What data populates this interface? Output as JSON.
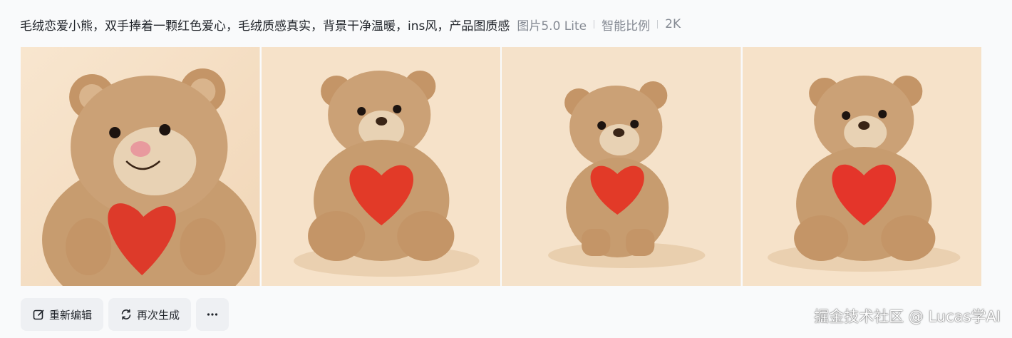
{
  "prompt": {
    "text": "毛绒恋爱小熊，双手捧着一颗红色爱心，毛绒质感真实，背景干净温暖，ins风，产品图质感",
    "model": "图片5.0 Lite",
    "ratio": "智能比例",
    "resolution": "2K"
  },
  "images": [
    {
      "name": "generated-image-1",
      "icon": "teddy-bear-heart"
    },
    {
      "name": "generated-image-2",
      "icon": "teddy-bear-heart"
    },
    {
      "name": "generated-image-3",
      "icon": "teddy-bear-heart"
    },
    {
      "name": "generated-image-4",
      "icon": "teddy-bear-heart"
    }
  ],
  "actions": {
    "reedit_label": "重新编辑",
    "regenerate_label": "再次生成",
    "more_icon": "more-icon"
  },
  "watermark": "掘金技术社区 @ Lucas学AI",
  "colors": {
    "background": "#f9fafb",
    "button_bg": "#eef0f3",
    "image_bg": "#f5e1c7",
    "bear_fur": "#c69a6d",
    "heart": "#e0392b"
  }
}
